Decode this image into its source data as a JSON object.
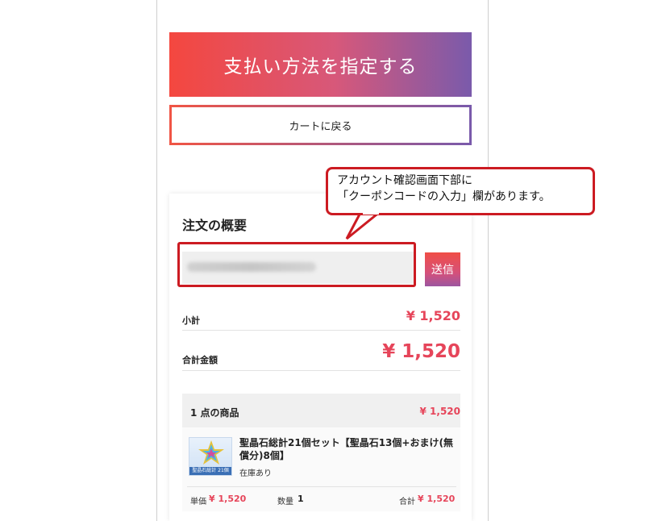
{
  "buttons": {
    "pay": "支払い方法を指定する",
    "back_to_cart": "カートに戻る",
    "send": "送信"
  },
  "summary": {
    "title": "注文の概要",
    "subtotal_label": "小計",
    "subtotal_value": "¥ 1,520",
    "total_label": "合計金額",
    "total_value": "¥ 1,520"
  },
  "items": {
    "count_label": "1 点の商品",
    "count_total": "¥ 1,520",
    "list": [
      {
        "title": "聖晶石総計21個セット【聖晶石13個+おまけ(無償分)8個】",
        "thumb_caption": "聖晶石総計 21個",
        "stock": "在庫あり",
        "unit_label": "単価",
        "unit_price": "¥ 1,520",
        "qty_label": "数量",
        "qty": "1",
        "total_label": "合計",
        "total_price": "¥ 1,520"
      }
    ]
  },
  "callout": {
    "line1": "アカウント確認画面下部に",
    "line2": "「クーポンコードの入力」欄があります。"
  },
  "colors": {
    "accent_red": "#e6455a",
    "highlight": "#cc1b22",
    "gradient_start": "#f4473f",
    "gradient_end": "#7a5aab"
  }
}
